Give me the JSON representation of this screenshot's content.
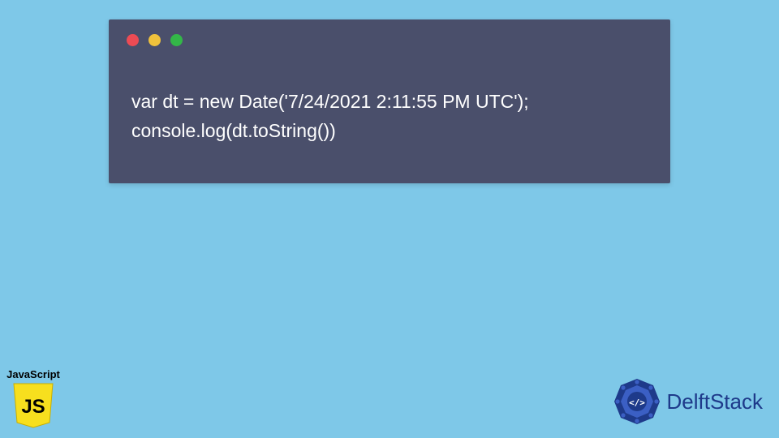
{
  "code": {
    "line1": "var dt = new Date('7/24/2021 2:11:55 PM UTC');",
    "line2": "console.log(dt.toString())"
  },
  "js_badge": {
    "label": "JavaScript",
    "glyph": "JS"
  },
  "brand": {
    "name": "DelftStack",
    "glyph": "</>"
  },
  "colors": {
    "page_bg": "#7ec8e8",
    "window_bg": "#4a4f6b",
    "js_yellow": "#f7df1e",
    "brand_blue": "#1e3a8a"
  }
}
